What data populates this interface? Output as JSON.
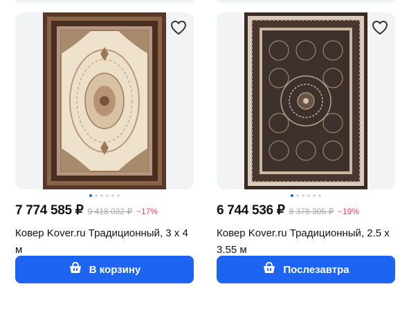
{
  "products": [
    {
      "price": "7 774 585 ₽",
      "old_price": "9 418 032 ₽",
      "discount": "−17%",
      "title": "Ковер Kover.ru Традиционный, 3 х 4 м",
      "button_label": "В корзину",
      "button_icon": "cart-icon",
      "image_dots": 6,
      "active_dot": 0
    },
    {
      "price": "6 744 536 ₽",
      "old_price": "8 378 305 ₽",
      "discount": "−19%",
      "title": "Ковер Kover.ru Традиционный, 2.5 х 3.55 м",
      "button_label": "Послезавтра",
      "button_icon": "cart-icon",
      "image_dots": 6,
      "active_dot": 0
    }
  ],
  "colors": {
    "accent": "#1d64f2",
    "discount": "#f0445a",
    "old_price": "#a5a8b0"
  }
}
